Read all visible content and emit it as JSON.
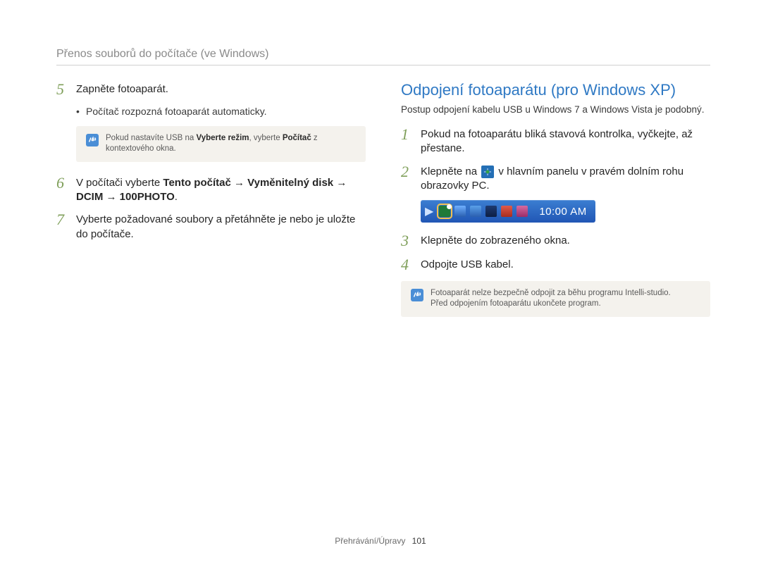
{
  "header": "Přenos souborů do počítače (ve Windows)",
  "left": {
    "steps": {
      "s5": {
        "num": "5",
        "text": "Zapněte fotoaparát."
      },
      "s5_bullet": "Počítač rozpozná fotoaparát automaticky.",
      "s5_note_pre": "Pokud nastavíte USB na ",
      "s5_note_b1": "Vyberte režim",
      "s5_note_mid": ", vyberte ",
      "s5_note_b2": "Počítač",
      "s5_note_post": " z kontextového okna.",
      "s6": {
        "num": "6",
        "pre": "V počítači vyberte ",
        "b1": "Tento počítač",
        "arr1": " → ",
        "b2": "Vyměnitelný disk",
        "arr2": " → ",
        "b3": "DCIM",
        "arr3": " → ",
        "b4": "100PHOTO",
        "post": "."
      },
      "s7": {
        "num": "7",
        "text": "Vyberte požadované soubory a přetáhněte je nebo je uložte do počítače."
      }
    }
  },
  "right": {
    "heading": "Odpojení fotoaparátu (pro Windows XP)",
    "intro": "Postup odpojení kabelu USB u Windows 7 a Windows Vista je podobný.",
    "steps": {
      "s1": {
        "num": "1",
        "text": "Pokud na fotoaparátu bliká stavová kontrolka, vyčkejte, až přestane."
      },
      "s2": {
        "num": "2",
        "pre": "Klepněte na ",
        "post": " v hlavním panelu v pravém dolním rohu obrazovky PC."
      },
      "taskbar_time": "10:00 AM",
      "s3": {
        "num": "3",
        "text": "Klepněte do zobrazeného okna."
      },
      "s4": {
        "num": "4",
        "text": "Odpojte USB kabel."
      }
    },
    "note_line1": "Fotoaparát nelze bezpečně odpojit za běhu programu Intelli-studio.",
    "note_line2": "Před odpojením fotoaparátu ukončete program."
  },
  "footer": {
    "section": "Přehrávání/Úpravy",
    "page": "101"
  }
}
